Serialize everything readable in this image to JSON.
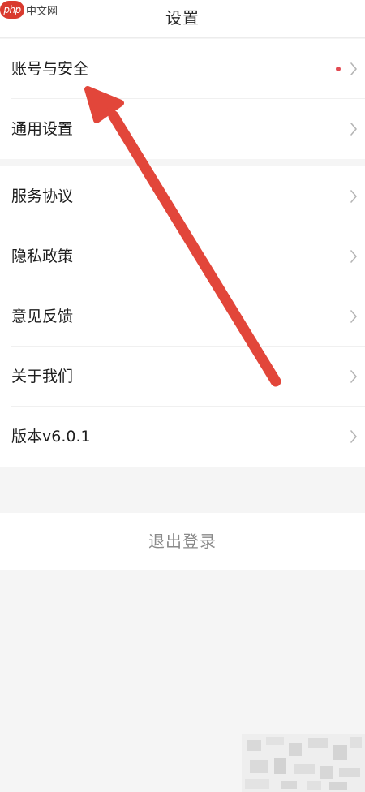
{
  "watermark": {
    "logo": "php",
    "text": "中文网"
  },
  "header": {
    "title": "设置"
  },
  "section1": {
    "items": [
      {
        "label": "账号与安全",
        "has_dot": true
      },
      {
        "label": "通用设置",
        "has_dot": false
      }
    ]
  },
  "section2": {
    "items": [
      {
        "label": "服务协议"
      },
      {
        "label": "隐私政策"
      },
      {
        "label": "意见反馈"
      },
      {
        "label": "关于我们"
      },
      {
        "label": "版本v6.0.1"
      }
    ]
  },
  "logout": {
    "label": "退出登录"
  },
  "colors": {
    "background": "#f5f5f5",
    "card": "#ffffff",
    "dot": "#e24a52",
    "arrow": "#e2463a",
    "logout_text": "#8a8a8a"
  }
}
